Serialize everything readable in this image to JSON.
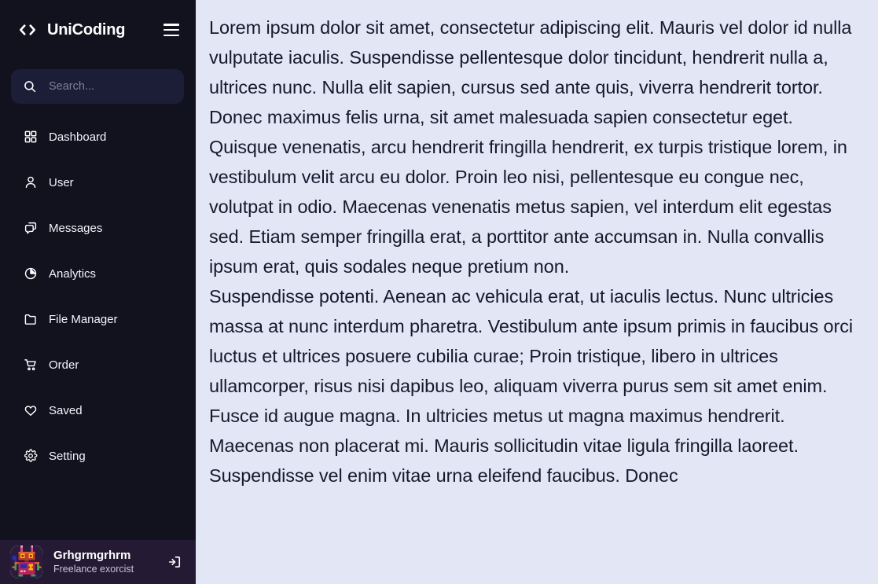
{
  "brand": {
    "name": "UniCoding",
    "logo_icon": "code-brackets-icon",
    "menu_icon": "hamburger-menu-icon"
  },
  "colors": {
    "sidebar_bg": "#12121f",
    "search_bg": "#1c1e38",
    "profile_bg": "#241a33",
    "content_bg": "#e2e6f5",
    "content_text": "#17192c",
    "sidebar_text": "#f2f3fa",
    "placeholder": "#7b7f9c"
  },
  "search": {
    "placeholder": "Search...",
    "value": "",
    "icon": "search-icon"
  },
  "sidebar": {
    "items": [
      {
        "label": "Dashboard",
        "icon": "grid-icon"
      },
      {
        "label": "User",
        "icon": "user-icon"
      },
      {
        "label": "Messages",
        "icon": "chat-bubbles-icon"
      },
      {
        "label": "Analytics",
        "icon": "pie-chart-icon"
      },
      {
        "label": "File Manager",
        "icon": "folder-icon"
      },
      {
        "label": "Order",
        "icon": "shopping-cart-icon"
      },
      {
        "label": "Saved",
        "icon": "heart-icon"
      },
      {
        "label": "Setting",
        "icon": "gear-icon"
      }
    ]
  },
  "profile": {
    "name": "Grhgrmgrhrm",
    "role": "Freelance exorcist",
    "avatar_icon": "pixel-robot-avatar",
    "logout_icon": "logout-icon"
  },
  "content": {
    "paragraphs": [
      "Lorem ipsum dolor sit amet, consectetur adipiscing elit. Mauris vel dolor id nulla vulputate iaculis. Suspendisse pellentesque dolor tincidunt, hendrerit nulla a, ultrices nunc. Nulla elit sapien, cursus sed ante quis, viverra hendrerit tortor. Donec maximus felis urna, sit amet malesuada sapien consectetur eget. Quisque venenatis, arcu hendrerit fringilla hendrerit, ex turpis tristique lorem, in vestibulum velit arcu eu dolor. Proin leo nisi, pellentesque eu congue nec, volutpat in odio. Maecenas venenatis metus sapien, vel interdum elit egestas sed. Etiam semper fringilla erat, a porttitor ante accumsan in. Nulla convallis ipsum erat, quis sodales neque pretium non.",
      "Suspendisse potenti. Aenean ac vehicula erat, ut iaculis lectus. Nunc ultricies massa at nunc interdum pharetra. Vestibulum ante ipsum primis in faucibus orci luctus et ultrices posuere cubilia curae; Proin tristique, libero in ultrices ullamcorper, risus nisi dapibus leo, aliquam viverra purus sem sit amet enim. Fusce id augue magna. In ultricies metus ut magna maximus hendrerit. Maecenas non placerat mi. Mauris sollicitudin vitae ligula fringilla laoreet. Suspendisse vel enim vitae urna eleifend faucibus. Donec"
    ]
  }
}
